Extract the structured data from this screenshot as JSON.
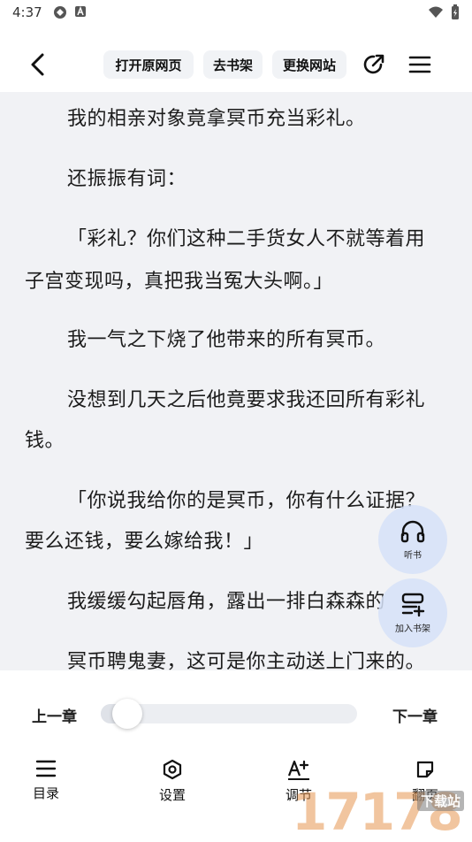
{
  "status_bar": {
    "time": "4:37"
  },
  "toolbar": {
    "open_original": "打开原网页",
    "to_bookshelf": "去书架",
    "change_source": "更换网站"
  },
  "content": {
    "paragraphs": [
      "我的相亲对象竟拿冥币充当彩礼。",
      "还振振有词：",
      "「彩礼？你们这种二手货女人不就等着用",
      "子宫变现吗，真把我当冤大头啊。」",
      "我一气之下烧了他带来的所有冥币。",
      "没想到几天之后他竟要求我还回所有彩礼",
      "钱。",
      "「你说我给你的是冥币，你有什么证据？",
      "要么还钱，要么嫁给我！」",
      "我缓缓勾起唇角，露出一排白森森的",
      "冥币聘鬼妻，这可是你主动送上门来的。"
    ]
  },
  "fabs": {
    "listen": "听书",
    "add_shelf": "加入书架"
  },
  "chapter_nav": {
    "prev": "上一章",
    "next": "下一章",
    "progress": 0.05
  },
  "bottom_nav": {
    "toc": "目录",
    "settings": "设置",
    "font": "调节",
    "page_turn": "翻页"
  },
  "watermark": {
    "logo": "17178",
    "site": "下载站"
  }
}
